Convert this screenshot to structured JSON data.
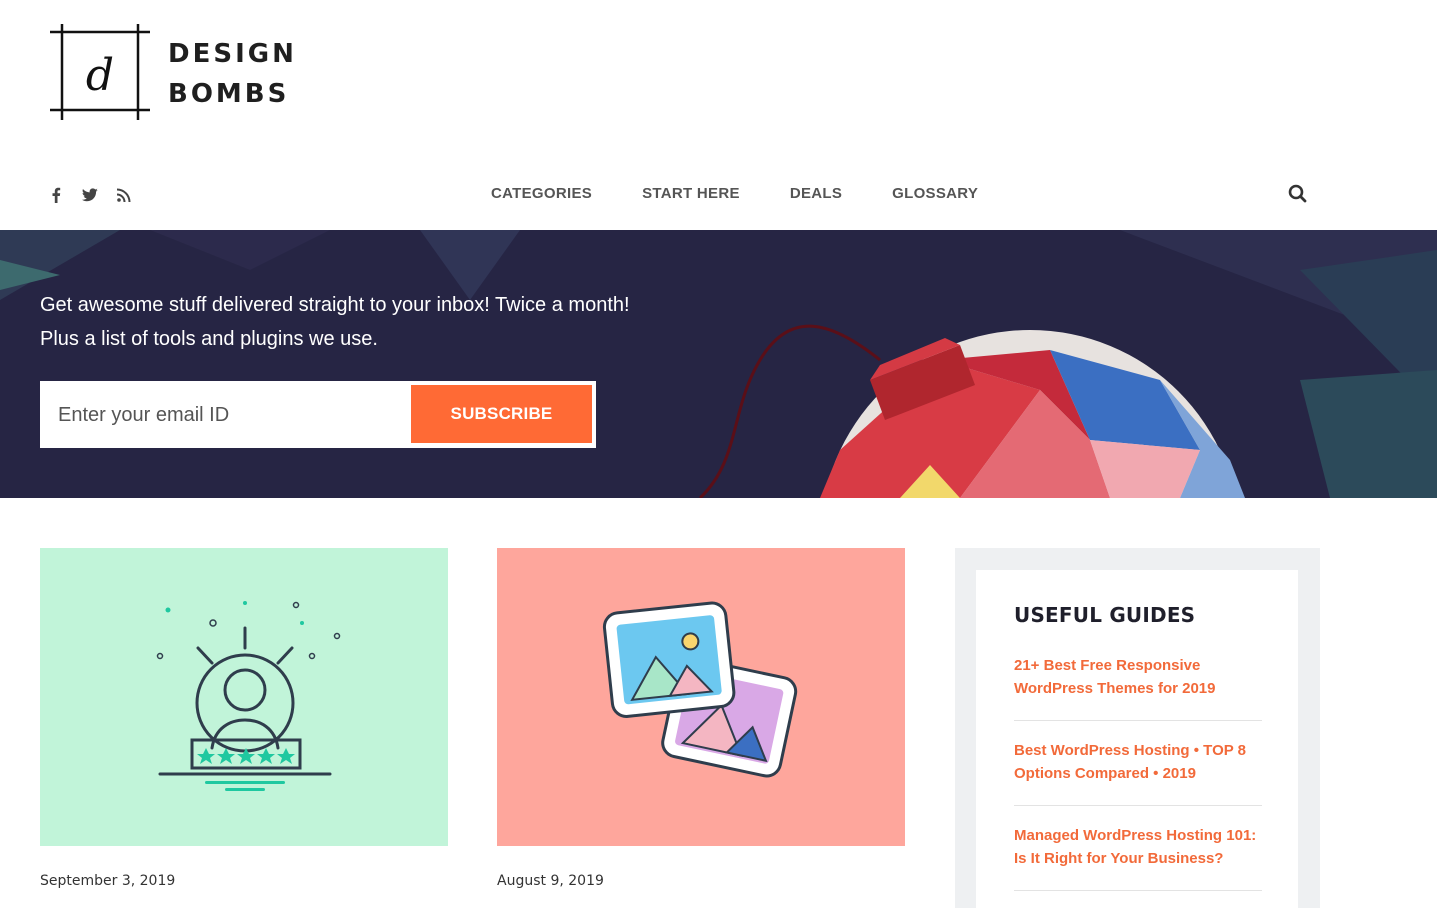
{
  "brand": {
    "logo_letter": "d",
    "name_line1": "DESIGN",
    "name_line2": "BOMBS"
  },
  "social": [
    "facebook-icon",
    "twitter-icon",
    "rss-icon"
  ],
  "nav": {
    "items": [
      {
        "label": "CATEGORIES"
      },
      {
        "label": "START HERE"
      },
      {
        "label": "DEALS"
      },
      {
        "label": "GLOSSARY"
      }
    ]
  },
  "hero": {
    "line1": "Get awesome stuff delivered straight to your inbox! Twice a month!",
    "line2": "Plus a list of tools and plugins we use.",
    "email_placeholder": "Enter your email ID",
    "subscribe_label": "SUBSCRIBE"
  },
  "posts": [
    {
      "date": "September 3, 2019",
      "thumb_color": "#c1f4d9",
      "icon": "user-rating-icon"
    },
    {
      "date": "August 9, 2019",
      "thumb_color": "#fea69c",
      "icon": "images-icon"
    }
  ],
  "sidebar": {
    "title": "USEFUL GUIDES",
    "guides": [
      {
        "label": "21+ Best Free Responsive WordPress Themes for 2019"
      },
      {
        "label": "Best WordPress Hosting • TOP 8 Options Compared • 2019"
      },
      {
        "label": "Managed WordPress Hosting 101: Is It Right for Your Business?"
      }
    ]
  },
  "colors": {
    "accent": "#ff6a35",
    "hero_bg": "#262544",
    "link": "#f26a3a"
  }
}
